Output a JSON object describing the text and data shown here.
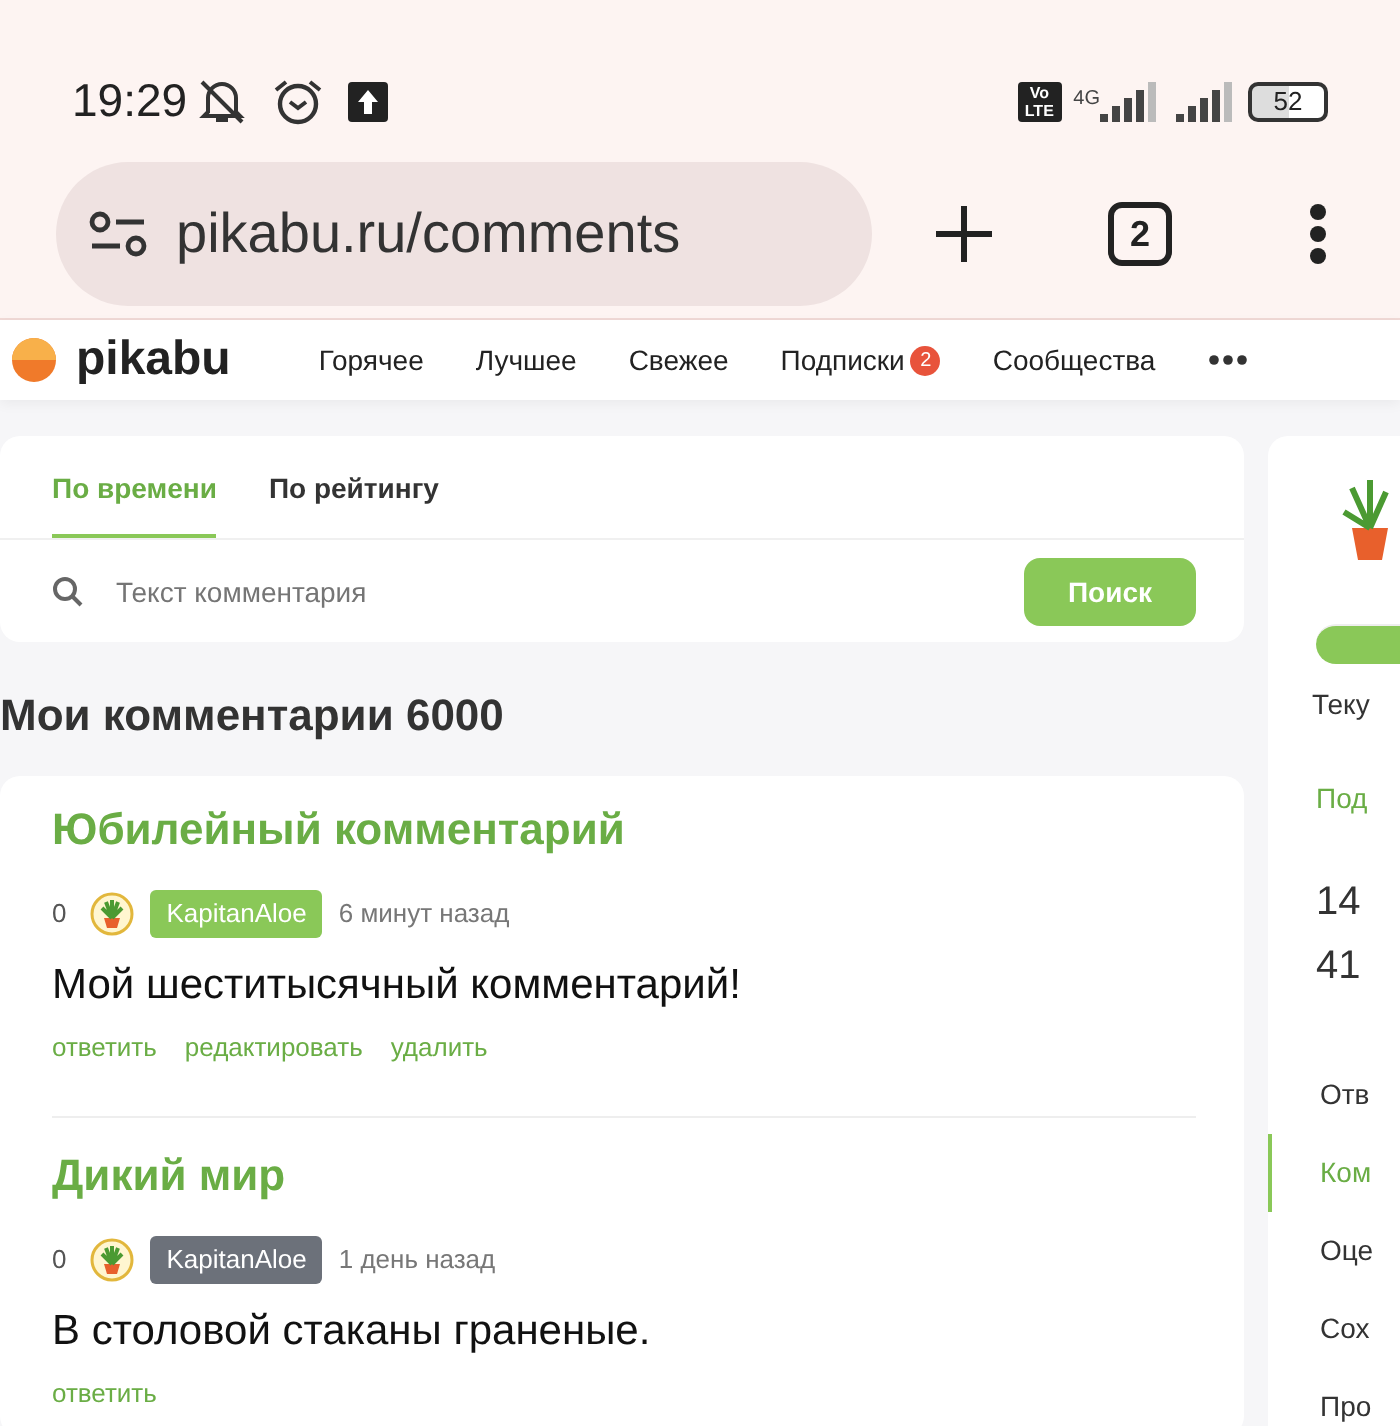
{
  "status_bar": {
    "time": "19:29",
    "volte": "Vo LTE",
    "network": "4G",
    "battery": "52"
  },
  "browser": {
    "url": "pikabu.ru/comments",
    "tab_count": "2"
  },
  "site_header": {
    "logo": "pikabu",
    "nav": [
      {
        "label": "Горячее"
      },
      {
        "label": "Лучшее"
      },
      {
        "label": "Свежее"
      },
      {
        "label": "Подписки",
        "badge": "2"
      },
      {
        "label": "Сообщества"
      }
    ]
  },
  "sort_tabs": [
    {
      "label": "По времени",
      "selected": true
    },
    {
      "label": "По рейтингу",
      "selected": false
    }
  ],
  "search": {
    "placeholder": "Текст комментария",
    "button": "Поиск"
  },
  "heading": "Мои комментарии 6000",
  "comments": [
    {
      "title": "Юбилейный комментарий",
      "rating": "0",
      "author": "KapitanAloe",
      "color": "#8ac858",
      "time": "6 минут назад",
      "text": "Мой шеститысячный комментарий!",
      "actions": [
        "ответить",
        "редактировать",
        "удалить"
      ]
    },
    {
      "title": "Дикий мир",
      "rating": "0",
      "author": "KapitanAloe",
      "color": "#6c717a",
      "time": "1 день назад",
      "text": "В столовой стаканы граненые.",
      "actions": [
        "ответить"
      ]
    }
  ],
  "sidebar": {
    "current": "Теку",
    "subscribe": "Под",
    "stats": [
      "14",
      "41"
    ],
    "menu": [
      {
        "label": "Отв",
        "selected": false
      },
      {
        "label": "Ком",
        "selected": true
      },
      {
        "label": "Оце",
        "selected": false
      },
      {
        "label": "Сох",
        "selected": false
      },
      {
        "label": "Про",
        "selected": false
      }
    ]
  }
}
